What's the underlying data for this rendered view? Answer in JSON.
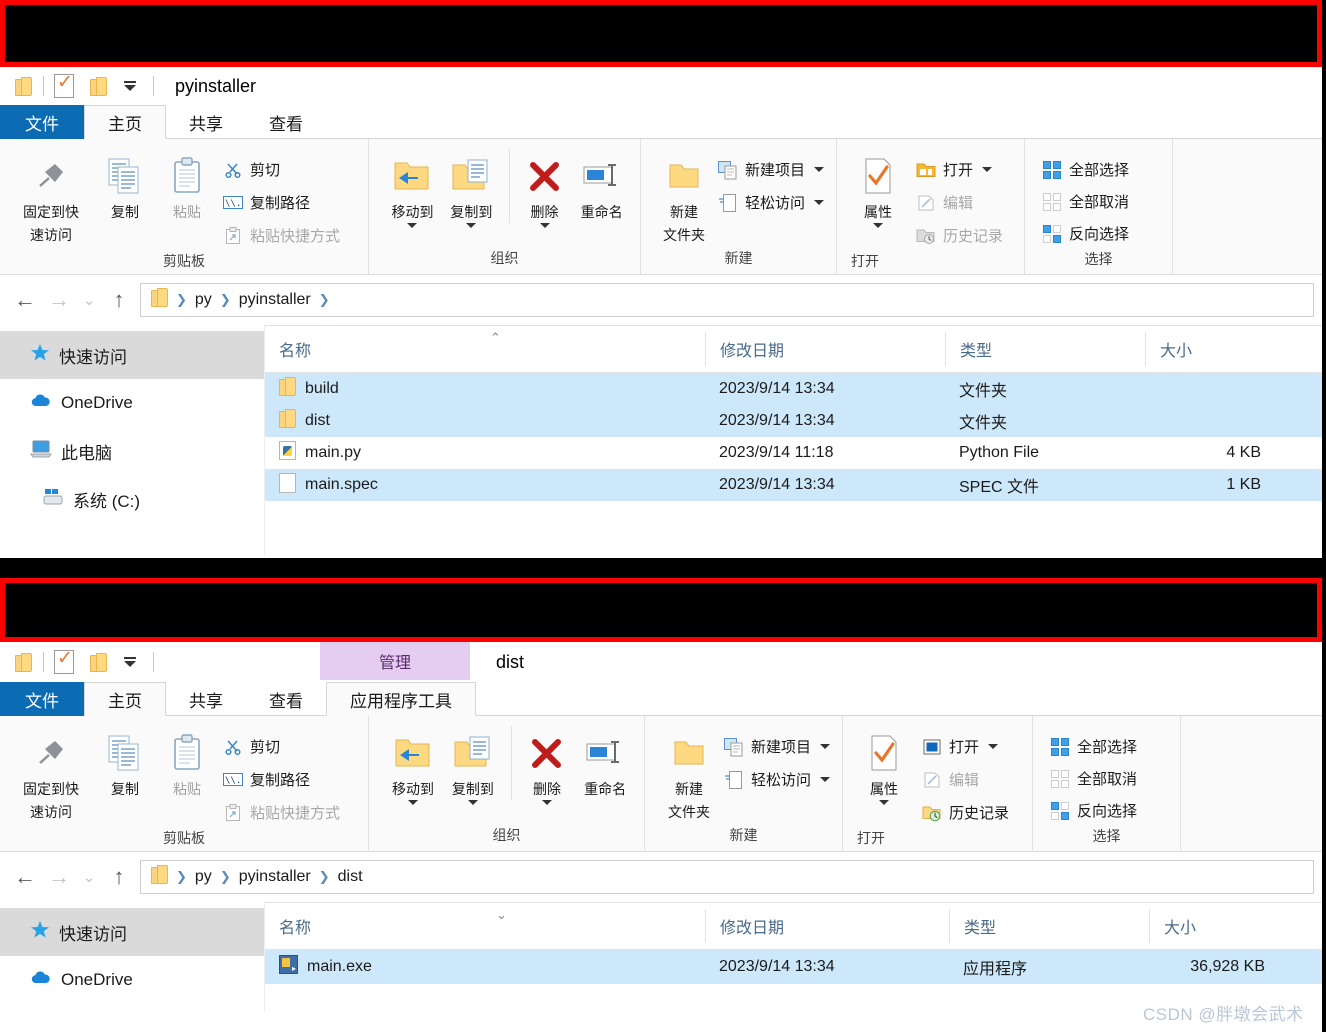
{
  "window1": {
    "title": "pyinstaller",
    "tabs": [
      {
        "label": "文件",
        "state": "file"
      },
      {
        "label": "主页",
        "state": "active"
      },
      {
        "label": "共享",
        "state": "normal"
      },
      {
        "label": "查看",
        "state": "normal"
      }
    ],
    "ribbon": {
      "clipboard": {
        "group_label": "剪贴板",
        "pin": "固定到快\n速访问",
        "pin_line1": "固定到快",
        "pin_line2": "速访问",
        "copy": "复制",
        "paste": "粘贴",
        "cut": "剪切",
        "copy_path": "复制路径",
        "paste_shortcut": "粘贴快捷方式"
      },
      "organize": {
        "group_label": "组织",
        "move_to": "移动到",
        "copy_to": "复制到",
        "delete": "删除",
        "rename": "重命名"
      },
      "new": {
        "group_label": "新建",
        "new_folder_l1": "新建",
        "new_folder_l2": "文件夹",
        "new_item": "新建项目",
        "easy_access": "轻松访问"
      },
      "open": {
        "group_label": "打开",
        "properties": "属性",
        "open": "打开",
        "edit": "编辑",
        "history": "历史记录"
      },
      "select": {
        "group_label": "选择",
        "select_all": "全部选择",
        "select_none": "全部取消",
        "invert": "反向选择"
      }
    },
    "address": {
      "crumbs": [
        "py",
        "pyinstaller"
      ],
      "trailing_sep": true
    },
    "navpane": [
      {
        "label": "快速访问",
        "icon": "star-icon",
        "selected": true,
        "indent": false
      },
      {
        "label": "OneDrive",
        "icon": "cloud-icon",
        "selected": false,
        "indent": false
      },
      {
        "label": "此电脑",
        "icon": "computer-icon",
        "selected": false,
        "indent": false
      },
      {
        "label": "系统 (C:)",
        "icon": "drive-icon",
        "selected": false,
        "indent": true
      }
    ],
    "columns": [
      "名称",
      "修改日期",
      "类型",
      "大小"
    ],
    "sort_direction": "asc",
    "files": [
      {
        "name": "build",
        "icon": "folder-icon",
        "date": "2023/9/14 13:34",
        "type": "文件夹",
        "size": "",
        "selected": true
      },
      {
        "name": "dist",
        "icon": "folder-icon",
        "date": "2023/9/14 13:34",
        "type": "文件夹",
        "size": "",
        "selected": true
      },
      {
        "name": "main.py",
        "icon": "python-file-icon",
        "date": "2023/9/14 11:18",
        "type": "Python File",
        "size": "4 KB",
        "selected": false
      },
      {
        "name": "main.spec",
        "icon": "spec-file-icon",
        "date": "2023/9/14 13:34",
        "type": "SPEC 文件",
        "size": "1 KB",
        "selected": true
      }
    ]
  },
  "window2": {
    "title": "dist",
    "contextual_tab_group": "管理",
    "tabs": [
      {
        "label": "文件",
        "state": "file"
      },
      {
        "label": "主页",
        "state": "active"
      },
      {
        "label": "共享",
        "state": "normal"
      },
      {
        "label": "查看",
        "state": "normal"
      },
      {
        "label": "应用程序工具",
        "state": "apptools"
      }
    ],
    "ribbon": {
      "clipboard": {
        "group_label": "剪贴板",
        "pin_line1": "固定到快",
        "pin_line2": "速访问",
        "copy": "复制",
        "paste": "粘贴",
        "cut": "剪切",
        "copy_path": "复制路径",
        "paste_shortcut": "粘贴快捷方式"
      },
      "organize": {
        "group_label": "组织",
        "move_to": "移动到",
        "copy_to": "复制到",
        "delete": "删除",
        "rename": "重命名"
      },
      "new": {
        "group_label": "新建",
        "new_folder_l1": "新建",
        "new_folder_l2": "文件夹",
        "new_item": "新建项目",
        "easy_access": "轻松访问"
      },
      "open": {
        "group_label": "打开",
        "properties": "属性",
        "open": "打开",
        "edit": "编辑",
        "history": "历史记录"
      },
      "select": {
        "group_label": "选择",
        "select_all": "全部选择",
        "select_none": "全部取消",
        "invert": "反向选择"
      }
    },
    "address": {
      "crumbs": [
        "py",
        "pyinstaller",
        "dist"
      ],
      "trailing_sep": false
    },
    "navpane": [
      {
        "label": "快速访问",
        "icon": "star-icon",
        "selected": true,
        "indent": false
      },
      {
        "label": "OneDrive",
        "icon": "cloud-icon",
        "selected": false,
        "indent": false
      }
    ],
    "columns": [
      "名称",
      "修改日期",
      "类型",
      "大小"
    ],
    "sort_direction": "desc",
    "files": [
      {
        "name": "main.exe",
        "icon": "exe-file-icon",
        "date": "2023/9/14 13:34",
        "type": "应用程序",
        "size": "36,928 KB",
        "selected": true
      }
    ]
  },
  "watermark": "CSDN @胖墩会武术",
  "colors": {
    "accent": "#0b6cb4",
    "selection": "#cde8fb",
    "redaction_border": "#fe0000",
    "redaction_fill": "#000000",
    "contextual_tab": "#e4cdf0"
  }
}
